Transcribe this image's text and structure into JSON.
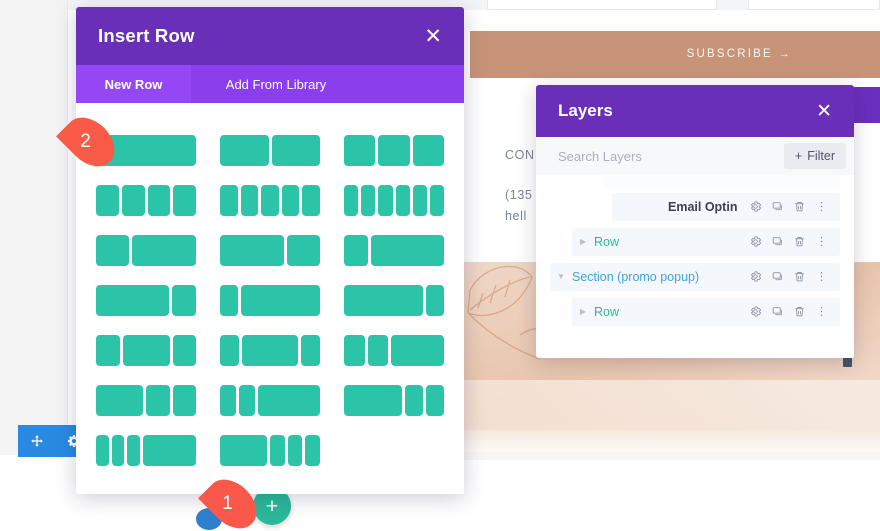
{
  "page_background": {
    "subscribe_button_label": "SUBSCRIBE →",
    "contact_lines": [
      "CON",
      "(135",
      "hell"
    ],
    "accent_peach": "#e8c4ac",
    "accent_purple": "#6b2fbd"
  },
  "element_toolbar": {
    "icons": [
      {
        "name": "move-icon",
        "label": "Move"
      },
      {
        "name": "gear-icon",
        "label": "Settings"
      }
    ],
    "background_color": "#2a8ae2"
  },
  "add_row_button": {
    "label": "+",
    "color": "#2bb99b"
  },
  "callouts": [
    {
      "number": "1",
      "color": "#fa5a48"
    },
    {
      "number": "2",
      "color": "#fa5a48"
    }
  ],
  "insert_row_modal": {
    "title": "Insert Row",
    "close_label": "✕",
    "header_color": "#6a2fb8",
    "tabs": [
      {
        "label": "New Row",
        "active": true
      },
      {
        "label": "Add From Library",
        "active": false
      }
    ],
    "column_color": "#2bc4a9",
    "layouts": [
      {
        "name": "1 column",
        "widths": [
          100
        ]
      },
      {
        "name": "2 columns equal",
        "widths": [
          50,
          50
        ]
      },
      {
        "name": "3 columns equal",
        "widths": [
          33.33,
          33.33,
          33.33
        ]
      },
      {
        "name": "4 columns equal",
        "widths": [
          25,
          25,
          25,
          25
        ]
      },
      {
        "name": "5 columns equal",
        "widths": [
          20,
          20,
          20,
          20,
          20
        ]
      },
      {
        "name": "6 columns equal",
        "widths": [
          16.6,
          16.6,
          16.6,
          16.6,
          16.6,
          16.6
        ]
      },
      {
        "name": "1/3 2/3",
        "widths": [
          34,
          66
        ]
      },
      {
        "name": "2/3 1/3",
        "widths": [
          66,
          34
        ]
      },
      {
        "name": "1/4 3/4",
        "widths": [
          25,
          75
        ]
      },
      {
        "name": "3/4 1/4",
        "widths": [
          75,
          25
        ]
      },
      {
        "name": "1/5 4/5",
        "widths": [
          19,
          81
        ]
      },
      {
        "name": "4/5 1/5",
        "widths": [
          81,
          19
        ]
      },
      {
        "name": "1/4 1/2 1/4",
        "widths": [
          25,
          50,
          25
        ]
      },
      {
        "name": "1/5 3/5 1/5",
        "widths": [
          20,
          60,
          20
        ]
      },
      {
        "name": "1/4 1/4 1/2",
        "widths": [
          22,
          22,
          56
        ]
      },
      {
        "name": "1/2 1/4 1/4",
        "widths": [
          50,
          25,
          25
        ]
      },
      {
        "name": "1/6 1/6 2/3",
        "widths": [
          17,
          17,
          66
        ]
      },
      {
        "name": "2/3 1/6 1/6",
        "widths": [
          62,
          19,
          19
        ]
      },
      {
        "name": "1/6 1/6 1/6 1/2",
        "widths": [
          14,
          14,
          14,
          58
        ]
      },
      {
        "name": "1/2 1/6 1/6 1/6",
        "widths": [
          52,
          16,
          16,
          16
        ]
      }
    ]
  },
  "layers_modal": {
    "title": "Layers",
    "close_label": "✕",
    "header_color": "#6a2fb8",
    "search": {
      "placeholder": "Search Layers",
      "value": ""
    },
    "filter_button": {
      "label": "Filter",
      "plus": "+"
    },
    "row_actions": [
      {
        "name": "gear-icon"
      },
      {
        "name": "duplicate-icon"
      },
      {
        "name": "trash-icon"
      },
      {
        "name": "more-options-icon"
      }
    ],
    "rows": [
      {
        "label": "Email Optin",
        "indent": 3,
        "color": "#3c4250",
        "caret": "none",
        "clipped": false
      },
      {
        "label": "Row",
        "indent": 2,
        "color": "#2bb99b",
        "caret": "collapsed",
        "clipped": false
      },
      {
        "label": "Section (promo popup)",
        "indent": 1,
        "color": "#3ba7e0",
        "caret": "expanded",
        "clipped": false
      },
      {
        "label": "Row",
        "indent": 2,
        "color": "#2bb99b",
        "caret": "collapsed",
        "clipped": false
      }
    ]
  },
  "scrollbar": {
    "name": "page-scrollbar-thumb",
    "color": "#44556b"
  }
}
